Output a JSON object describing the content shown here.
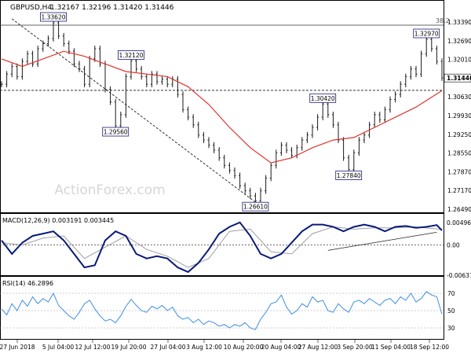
{
  "header": {
    "symbol": "GBPUSD,H4",
    "ohlc": "1.32167 1.32196 1.31420 1.31446"
  },
  "watermark": "ActionForex.com",
  "colors": {
    "price": "#1a1a1a",
    "ma": "#e0332b",
    "macd": "#0a1a7a",
    "signal": "#a0a0a0",
    "rsi": "#3c8fe6",
    "label_border": "#1a1a7a",
    "frame": "#000000"
  },
  "chart_data": [
    {
      "type": "line",
      "title": "GBPUSD,H4",
      "ylim": [
        1.264,
        1.339
      ],
      "y_ticks": [
        "1.33390",
        "1.32690",
        "1.32010",
        "1.31310",
        "1.30630",
        "1.29930",
        "1.29250",
        "1.28550",
        "1.27870",
        "1.27170",
        "1.26490"
      ],
      "current_price": "1.31446",
      "x_labels": [
        "27 Jun 2018",
        "5 Jul 04:00",
        "12 Jul 12:00",
        "19 Jul 20:00",
        "27 Jul 04:00",
        "3 Aug 12:00",
        "10 Aug 20:00",
        "20 Aug 04:00",
        "27 Aug 12:00",
        "3 Sep 20:00",
        "11 Sep 04:00",
        "18 Sep 12:00"
      ],
      "annotations": [
        {
          "label": "1.33620",
          "x": 10,
          "y": 1.3362
        },
        {
          "label": "1.32120",
          "x": 25,
          "y": 1.3212
        },
        {
          "label": "1.29560",
          "x": 22,
          "y": 1.2956
        },
        {
          "label": "1.26610",
          "x": 49,
          "y": 1.2661
        },
        {
          "label": "1.30420",
          "x": 62,
          "y": 1.3042
        },
        {
          "label": "1.27840",
          "x": 67,
          "y": 1.2784
        },
        {
          "label": "1.32970",
          "x": 82,
          "y": 1.3297
        }
      ],
      "horizontal_level": 1.3096,
      "fib_label": "38.2",
      "trendline": [
        [
          2,
          1.3378
        ],
        [
          49,
          1.2655
        ]
      ],
      "series": [
        {
          "role": "price",
          "x": [
            0,
            1,
            2,
            3,
            4,
            5,
            6,
            7,
            8,
            9,
            10,
            11,
            12,
            13,
            14,
            15,
            16,
            17,
            18,
            19,
            20,
            21,
            22,
            23,
            24,
            25,
            26,
            27,
            28,
            29,
            30,
            31,
            32,
            33,
            34,
            35,
            36,
            37,
            38,
            39,
            40,
            41,
            42,
            43,
            44,
            45,
            46,
            47,
            48,
            49,
            50,
            51,
            52,
            53,
            54,
            55,
            56,
            57,
            58,
            59,
            60,
            61,
            62,
            63,
            64,
            65,
            66,
            67,
            68,
            69,
            70,
            71,
            72,
            73,
            74,
            75,
            76,
            77,
            78,
            79,
            80,
            81,
            82,
            83,
            84,
            85
          ],
          "values": [
            1.312,
            1.316,
            1.319,
            1.315,
            1.321,
            1.324,
            1.32,
            1.326,
            1.328,
            1.33,
            1.3362,
            1.331,
            1.328,
            1.325,
            1.32,
            1.318,
            1.312,
            1.322,
            1.326,
            1.32,
            1.31,
            1.305,
            1.2956,
            1.3,
            1.315,
            1.3212,
            1.318,
            1.315,
            1.312,
            1.316,
            1.313,
            1.314,
            1.312,
            1.314,
            1.308,
            1.302,
            1.299,
            1.296,
            1.292,
            1.29,
            1.288,
            1.286,
            1.283,
            1.28,
            1.278,
            1.276,
            1.272,
            1.27,
            1.268,
            1.2661,
            1.27,
            1.275,
            1.28,
            1.285,
            1.288,
            1.286,
            1.284,
            1.287,
            1.29,
            1.292,
            1.295,
            1.299,
            1.3042,
            1.3,
            1.296,
            1.29,
            1.283,
            1.2784,
            1.285,
            1.29,
            1.292,
            1.296,
            1.3,
            1.298,
            1.302,
            1.306,
            1.308,
            1.312,
            1.315,
            1.318,
            1.316,
            1.324,
            1.3297,
            1.326,
            1.321,
            1.3145
          ]
        },
        {
          "role": "moving_average",
          "x": [
            0,
            4,
            8,
            12,
            16,
            20,
            24,
            28,
            32,
            36,
            40,
            44,
            48,
            52,
            56,
            60,
            64,
            68,
            72,
            76,
            80,
            85
          ],
          "values": [
            1.322,
            1.319,
            1.322,
            1.325,
            1.323,
            1.32,
            1.317,
            1.316,
            1.315,
            1.311,
            1.304,
            1.295,
            1.287,
            1.281,
            1.283,
            1.287,
            1.29,
            1.291,
            1.295,
            1.299,
            1.303,
            1.3095
          ]
        }
      ]
    },
    {
      "type": "line",
      "title": "MACD(12,26,9) 0.003191 0.003445",
      "ylim": [
        -0.00637,
        0.00496
      ],
      "y_ticks": [
        "0.004968",
        "0.00",
        "-0.006372"
      ],
      "trendline": [
        [
          63,
          -0.0012
        ],
        [
          84,
          0.0028
        ]
      ],
      "series": [
        {
          "role": "macd",
          "x": [
            0,
            2,
            4,
            6,
            8,
            10,
            12,
            14,
            16,
            18,
            20,
            22,
            24,
            26,
            28,
            30,
            32,
            34,
            36,
            38,
            40,
            42,
            44,
            46,
            48,
            50,
            52,
            54,
            56,
            58,
            60,
            62,
            64,
            66,
            68,
            70,
            72,
            74,
            76,
            78,
            80,
            82,
            84,
            85
          ],
          "values": [
            0.001,
            -0.002,
            0.0005,
            0.002,
            0.0025,
            0.003,
            0.001,
            -0.002,
            -0.005,
            -0.0045,
            0.001,
            0.003,
            0.002,
            -0.002,
            -0.003,
            -0.0025,
            -0.003,
            -0.005,
            -0.006,
            -0.004,
            -0.001,
            0.0025,
            0.004,
            0.005,
            0.002,
            -0.002,
            -0.003,
            -0.002,
            0.0005,
            0.003,
            0.0045,
            0.0045,
            0.004,
            0.003,
            0.004,
            0.0045,
            0.004,
            0.003,
            0.004,
            0.0042,
            0.0038,
            0.004,
            0.0044,
            0.0032
          ]
        },
        {
          "role": "signal",
          "x": [
            0,
            4,
            8,
            12,
            16,
            20,
            24,
            28,
            32,
            36,
            40,
            44,
            48,
            52,
            56,
            60,
            64,
            68,
            72,
            76,
            80,
            85
          ],
          "values": [
            0.0005,
            0.0,
            0.0015,
            0.002,
            -0.003,
            -0.0005,
            0.002,
            -0.001,
            -0.0025,
            -0.005,
            -0.003,
            0.003,
            0.0035,
            -0.0015,
            -0.002,
            0.0025,
            0.004,
            0.0035,
            0.0038,
            0.0038,
            0.004,
            0.0034
          ]
        }
      ]
    },
    {
      "type": "line",
      "title": "RSI(14) 46.2896",
      "ylim": [
        20,
        80
      ],
      "y_ticks": [
        "70",
        "50",
        "30"
      ],
      "series": [
        {
          "role": "rsi",
          "x": [
            0,
            1,
            2,
            3,
            4,
            5,
            6,
            7,
            8,
            9,
            10,
            11,
            12,
            13,
            14,
            15,
            16,
            17,
            18,
            19,
            20,
            21,
            22,
            23,
            24,
            25,
            26,
            27,
            28,
            29,
            30,
            31,
            32,
            33,
            34,
            35,
            36,
            37,
            38,
            39,
            40,
            41,
            42,
            43,
            44,
            45,
            46,
            47,
            48,
            49,
            50,
            51,
            52,
            53,
            54,
            55,
            56,
            57,
            58,
            59,
            60,
            61,
            62,
            63,
            64,
            65,
            66,
            67,
            68,
            69,
            70,
            71,
            72,
            73,
            74,
            75,
            76,
            77,
            78,
            79,
            80,
            81,
            82,
            83,
            84,
            85
          ],
          "values": [
            52,
            45,
            58,
            50,
            62,
            55,
            66,
            58,
            64,
            60,
            70,
            56,
            50,
            44,
            40,
            48,
            58,
            62,
            52,
            44,
            38,
            40,
            36,
            44,
            55,
            63,
            56,
            50,
            48,
            55,
            52,
            56,
            50,
            54,
            44,
            40,
            42,
            36,
            40,
            34,
            38,
            36,
            32,
            34,
            30,
            34,
            32,
            36,
            30,
            28,
            40,
            48,
            58,
            60,
            68,
            54,
            46,
            50,
            58,
            54,
            66,
            60,
            62,
            50,
            48,
            58,
            52,
            48,
            60,
            62,
            58,
            64,
            60,
            56,
            62,
            64,
            58,
            66,
            62,
            70,
            60,
            64,
            72,
            68,
            66,
            46
          ]
        }
      ]
    }
  ]
}
